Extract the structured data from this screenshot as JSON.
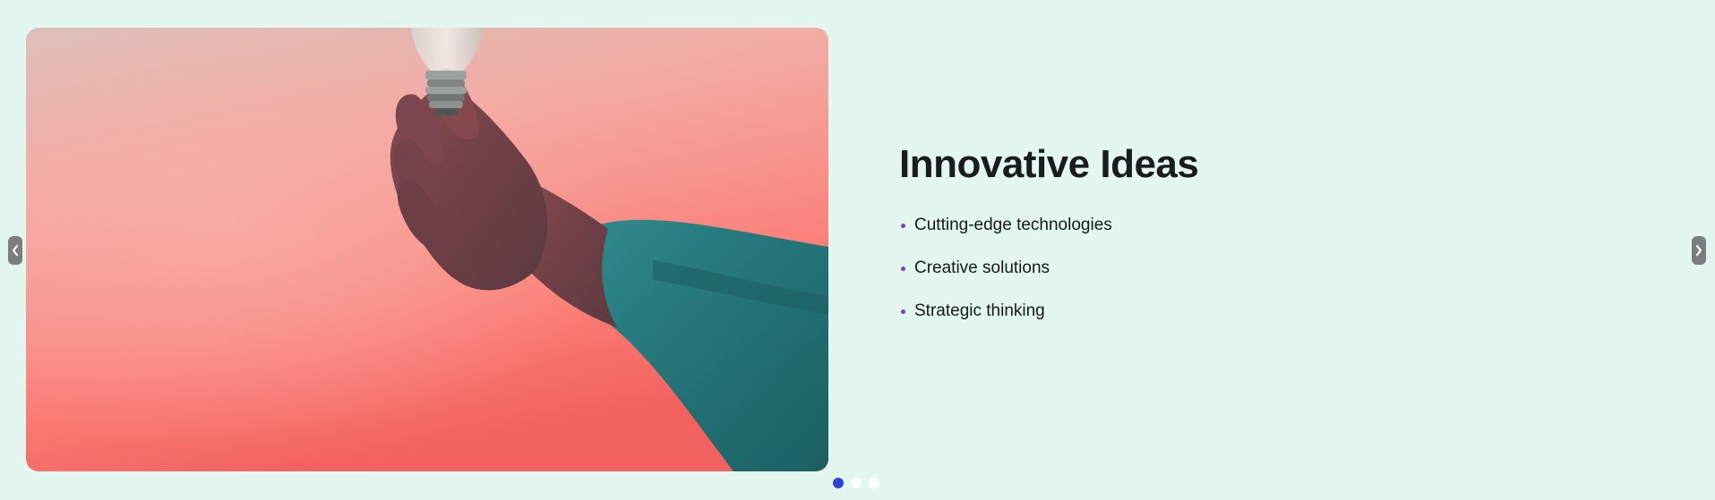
{
  "slide": {
    "title": "Innovative Ideas",
    "features": [
      "Cutting-edge technologies",
      "Creative solutions",
      "Strategic thinking"
    ],
    "image_alt": "hand holding a light bulb"
  },
  "carousel": {
    "prev_icon": "chevron-left-icon",
    "next_icon": "chevron-right-icon",
    "current_index": 1,
    "slide_count": 3
  },
  "colors": {
    "background": "#e3f6ef",
    "accent_dot_active": "#2c44d6",
    "bullet": "#7b3fbf",
    "nav_button": "#7b7d7f"
  }
}
